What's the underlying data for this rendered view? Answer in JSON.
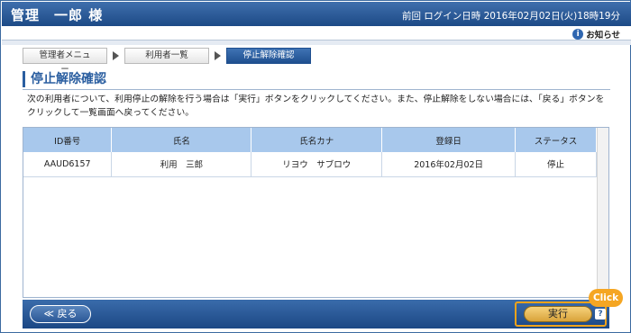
{
  "header": {
    "title": "管理　一郎 様",
    "last_login": "前回 ログイン日時 2016年02月02日(火)18時19分"
  },
  "notice": {
    "label": "お知らせ",
    "icon": "info-icon"
  },
  "breadcrumb": [
    {
      "label": "管理者メニュー"
    },
    {
      "label": "利用者一覧"
    },
    {
      "label": "停止解除確認"
    }
  ],
  "page": {
    "title": "停止解除確認",
    "message": "次の利用者について、利用停止の解除を行う場合は「実行」ボタンをクリックしてください。また、停止解除をしない場合には、「戻る」ボタンをクリックして一覧画面へ戻ってください。"
  },
  "table": {
    "headers": [
      "ID番号",
      "氏名",
      "氏名カナ",
      "登録日",
      "ステータス"
    ],
    "rows": [
      [
        "AAUD6157",
        "利用　三郎",
        "リヨウ　サブロウ",
        "2016年02月02日",
        "停止"
      ]
    ]
  },
  "footer": {
    "back_label": "≪ 戻る",
    "execute_label": "実行",
    "help_symbol": "?"
  },
  "callout": {
    "label": "Click",
    "color": "#f5a623"
  },
  "colors": {
    "header": "#1d4a86",
    "accent": "#2a5ea0",
    "table_header": "#a8c8ec",
    "execute_button": "#d9a33a"
  }
}
